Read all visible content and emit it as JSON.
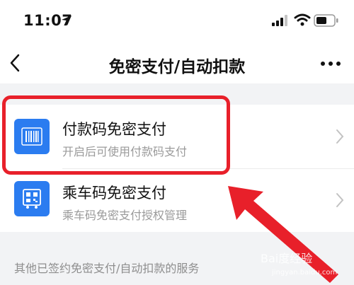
{
  "status_bar": {
    "time": "11:07"
  },
  "nav": {
    "title": "免密支付/自动扣款"
  },
  "payment_rows": [
    {
      "title": "付款码免密支付",
      "subtitle": "开启后可使用付款码支付",
      "icon": "barcode-icon"
    },
    {
      "title": "乘车码免密支付",
      "subtitle": "乘车码免密支付授权管理",
      "icon": "bus-qr-icon"
    }
  ],
  "section": {
    "label": "其他已签约免密支付/自动扣款的服务"
  },
  "annotation": {
    "highlight_color": "#e8202a",
    "arrow_color": "#e8202a"
  },
  "watermark": {
    "text": "Bai度经验",
    "sub": "jingyan.baidu.com"
  },
  "colors": {
    "accent": "#2b7cf0",
    "background": "#f2f3f5"
  }
}
